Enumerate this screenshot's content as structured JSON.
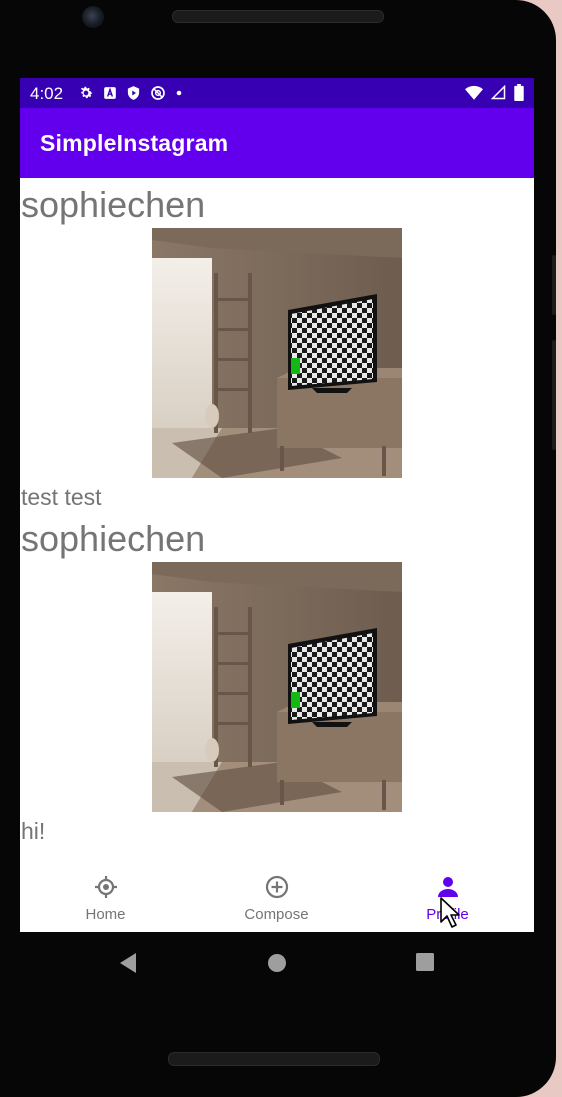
{
  "status_bar": {
    "time": "4:02",
    "left_icons": [
      "gear-icon",
      "a-icon",
      "shield-play-icon",
      "at-circle-icon",
      "dot-icon"
    ],
    "right_icons": [
      "wifi-icon",
      "cell-signal-icon",
      "battery-icon"
    ]
  },
  "app_bar": {
    "title": "SimpleInstagram"
  },
  "colors": {
    "status_bar": "#3700b3",
    "app_bar": "#6200ee",
    "active_nav": "#6200ee",
    "inactive_nav": "#757575"
  },
  "posts": [
    {
      "username": "sophiechen",
      "caption": "test test",
      "image": "room-with-tv-photo"
    },
    {
      "username": "sophiechen",
      "caption": "hi!",
      "image": "room-with-tv-photo"
    }
  ],
  "bottom_nav": [
    {
      "label": "Home",
      "icon": "home-target-icon",
      "active": false
    },
    {
      "label": "Compose",
      "icon": "add-circle-icon",
      "active": false
    },
    {
      "label": "Profile",
      "icon": "person-icon",
      "active": true
    }
  ],
  "system_nav": [
    "back-icon",
    "home-circle-icon",
    "recents-square-icon"
  ]
}
